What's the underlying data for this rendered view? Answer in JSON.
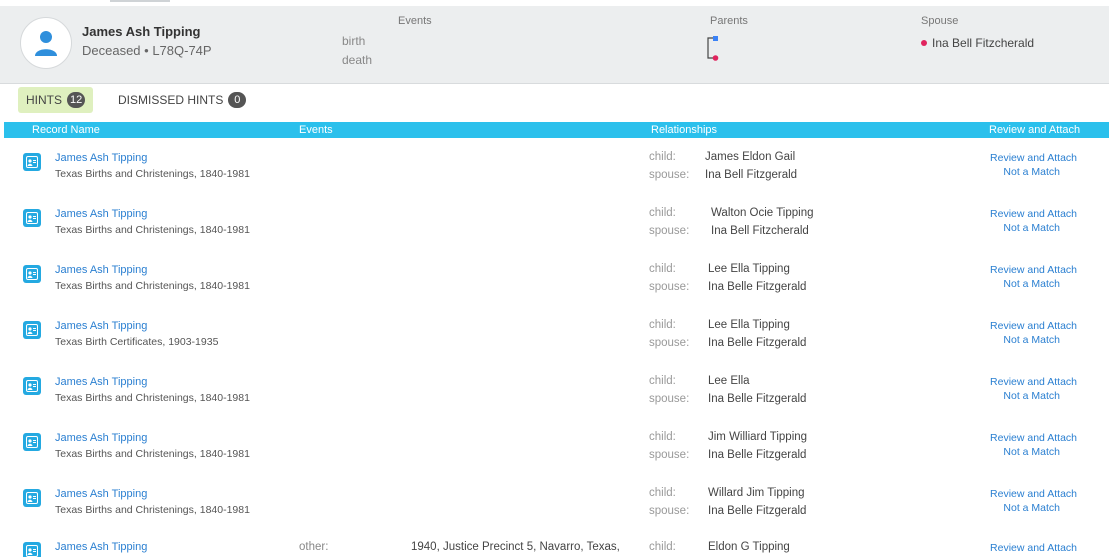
{
  "person": {
    "name": "James Ash Tipping",
    "subtitle": "Deceased • L78Q-74P",
    "events_heading": "Events",
    "birth_label": "birth",
    "death_label": "death",
    "parents_heading": "Parents",
    "spouse_heading": "Spouse",
    "spouse_name": "Ina Bell Fitzcherald"
  },
  "tabs": {
    "hints_label": "HINTS",
    "hints_count": "12",
    "dismissed_label": "DISMISSED HINTS",
    "dismissed_count": "0"
  },
  "table": {
    "headers": [
      "Record Name",
      "Events",
      "Relationships",
      "Review and Attach"
    ],
    "review_label": "Review and Attach",
    "not_match_label": "Not a Match",
    "rows": [
      {
        "name": "James Ash Tipping",
        "source": "Texas Births and Christenings, 1840-1981",
        "child_label": "child:",
        "child": "James Eldon Gail",
        "spouse_label": "spouse:",
        "spouse": "Ina Bell Fitzgerald"
      },
      {
        "name": "James Ash Tipping",
        "source": "Texas Births and Christenings, 1840-1981",
        "child_label": "child:",
        "child": "Walton Ocie Tipping",
        "spouse_label": "spouse:",
        "spouse": "Ina Bell Fitzcherald"
      },
      {
        "name": "James Ash Tipping",
        "source": "Texas Births and Christenings, 1840-1981",
        "child_label": "child:",
        "child": "Lee Ella Tipping",
        "spouse_label": "spouse:",
        "spouse": "Ina Belle Fitzgerald"
      },
      {
        "name": "James Ash Tipping",
        "source": "Texas Birth Certificates, 1903-1935",
        "child_label": "child:",
        "child": "Lee Ella Tipping",
        "spouse_label": "spouse:",
        "spouse": "Ina Belle Fitzgerald"
      },
      {
        "name": "James Ash Tipping",
        "source": "Texas Births and Christenings, 1840-1981",
        "child_label": "child:",
        "child": "Lee Ella",
        "spouse_label": "spouse:",
        "spouse": "Ina Belle Fitzgerald"
      },
      {
        "name": "James Ash Tipping",
        "source": "Texas Births and Christenings, 1840-1981",
        "child_label": "child:",
        "child": "Jim Williard Tipping",
        "spouse_label": "spouse:",
        "spouse": "Ina Belle Fitzgerald"
      },
      {
        "name": "James Ash Tipping",
        "source": "Texas Births and Christenings, 1840-1981",
        "child_label": "child:",
        "child": "Willard Jim Tipping",
        "spouse_label": "spouse:",
        "spouse": "Ina Belle Fitzgerald"
      },
      {
        "name": "James Ash Tipping",
        "event_label": "other:",
        "event_value": "1940, Justice Precinct 5, Navarro, Texas,",
        "child_label": "child:",
        "child": "Eldon G Tipping"
      }
    ]
  },
  "colors": {
    "header_bar": "#2bc0ec",
    "link": "#2a7fd1",
    "hints_tab_bg": "#dff0bf",
    "spouse_dot": "#e0245e",
    "father_marker": "#3b82f6"
  }
}
